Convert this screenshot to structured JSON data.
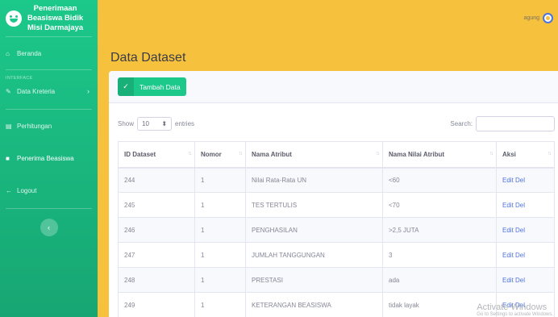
{
  "brand": {
    "line1": "Penerimaan",
    "line2": "Beasiswa Bidik",
    "line3": "Misi Darmajaya"
  },
  "sidebar": {
    "items": [
      {
        "label": "Beranda"
      },
      {
        "heading": "INTERFACE"
      },
      {
        "label": "Data Kreteria"
      },
      {
        "label": "Perhitungan"
      },
      {
        "label": "Penerima Beasiswa"
      },
      {
        "label": "Logout"
      }
    ]
  },
  "topbar": {
    "user": "agung"
  },
  "page": {
    "title": "Data Dataset"
  },
  "card": {
    "add_button": "Tambah Data"
  },
  "controls": {
    "show": "Show",
    "entries_value": "10",
    "entries": "entries",
    "search_label": "Search:"
  },
  "table": {
    "headers": [
      "ID Dataset",
      "Nomor",
      "Nama Atribut",
      "Nama Nilai Atribut",
      "Aksi"
    ],
    "rows": [
      {
        "id": "244",
        "nomor": "1",
        "atribut": "Nilai Rata-Rata UN",
        "nilai": "<60",
        "edit": "Edit",
        "del": "Del"
      },
      {
        "id": "245",
        "nomor": "1",
        "atribut": "TES TERTULIS",
        "nilai": "<70",
        "edit": "Edit",
        "del": "Del"
      },
      {
        "id": "246",
        "nomor": "1",
        "atribut": "PENGHASILAN",
        "nilai": ">2,5 JUTA",
        "edit": "Edit",
        "del": "Del"
      },
      {
        "id": "247",
        "nomor": "1",
        "atribut": "JUMLAH TANGGUNGAN",
        "nilai": "3",
        "edit": "Edit",
        "del": "Del"
      },
      {
        "id": "248",
        "nomor": "1",
        "atribut": "PRESTASI",
        "nilai": "ada",
        "edit": "Edit",
        "del": "Del"
      },
      {
        "id": "249",
        "nomor": "1",
        "atribut": "KETERANGAN BEASISWA",
        "nilai": "tidak layak",
        "edit": "Edit",
        "del": "Del"
      }
    ]
  },
  "watermark": {
    "line1": "Activate Windows",
    "line2": "Go to Settings to activate Windows."
  },
  "colors": {
    "sidebar": "#1cc88a",
    "topbar": "#f6c23e",
    "link": "#4e73df"
  }
}
